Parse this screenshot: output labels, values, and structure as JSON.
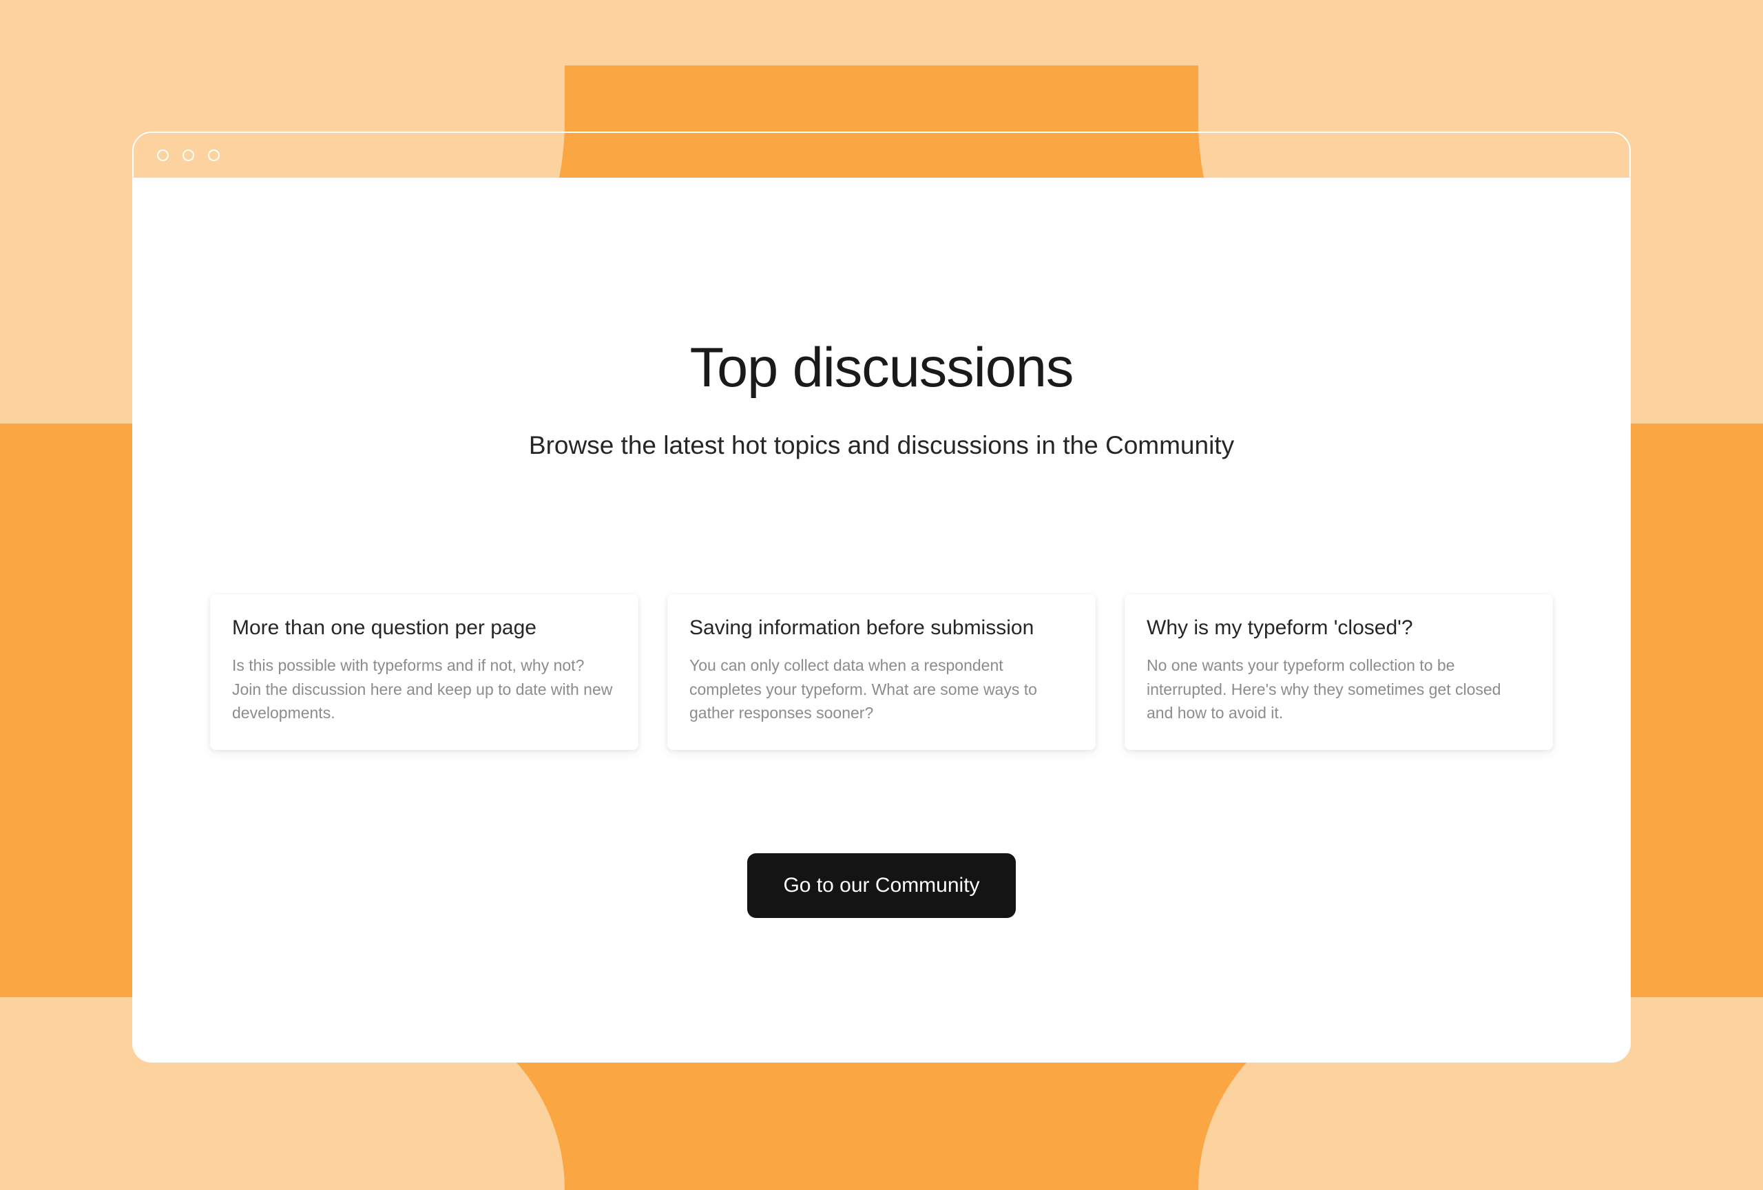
{
  "header": {
    "title": "Top discussions",
    "subtitle": "Browse the latest hot topics and discussions in the Community"
  },
  "cards": [
    {
      "title": "More than one question per page",
      "description": "Is this possible with typeforms and if not, why not? Join the discussion here and keep up to date with new developments."
    },
    {
      "title": "Saving information before submission",
      "description": "You can only collect data when a respondent completes your typeform. What are some ways to gather responses sooner?"
    },
    {
      "title": "Why is my typeform 'closed'?",
      "description": "No one wants your typeform collection to be interrupted. Here's why they sometimes get closed and how to avoid it."
    }
  ],
  "cta": {
    "label": "Go to our Community"
  },
  "colors": {
    "bg_light": "#FCD29F",
    "bg_orange": "#FAA642",
    "button_bg": "#141414",
    "text_dark": "#1a1a1a",
    "text_muted": "#8c8c8c"
  }
}
